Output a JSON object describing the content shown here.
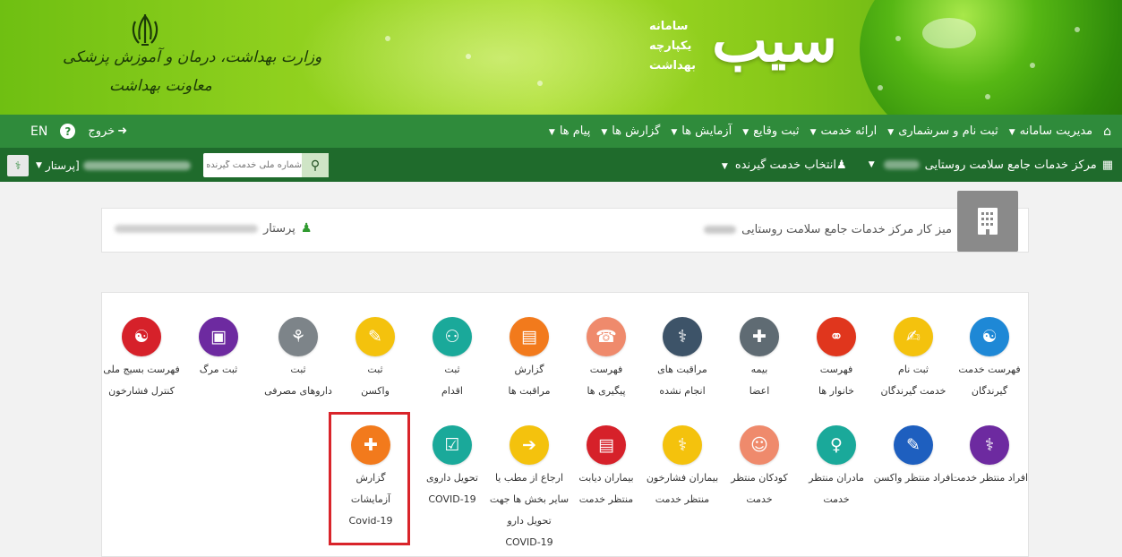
{
  "banner": {
    "ministry_line1": "وزارت بهداشت، درمان و آموزش پزشکی",
    "ministry_line2": "معاونت بهداشت",
    "logo_word": "سیب",
    "logo_line1": "سامانه",
    "logo_line2": "یکپارچه",
    "logo_line3": "بهداشت"
  },
  "mainnav": {
    "items": [
      "مدیریت سامانه",
      "ثبت نام و سرشماری",
      "ارائه خدمت",
      "ثبت وقایع",
      "آزمایش ها",
      "گزارش ها",
      "پیام ها"
    ],
    "home_icon": "home-icon",
    "exit_label": "خروج",
    "help_label": "?",
    "lang_label": "EN"
  },
  "subbar": {
    "center_label": "مرکز خدمات جامع سلامت روستایی",
    "select_client_label": "انتخاب خدمت گیرنده",
    "search_placeholder": "شماره ملی خدمت گیرنده",
    "role_label": "پرستار]"
  },
  "desk": {
    "title": "میز کار مرکز خدمات جامع سلامت روستایی",
    "user_role": "پرستار"
  },
  "tiles_row1": [
    {
      "l1": "فهرست خدمت",
      "l2": "گیرندگان",
      "color": "#1e88d6",
      "glyph": "👥"
    },
    {
      "l1": "ثبت نام",
      "l2": "خدمت گیرندگان",
      "color": "#f4c20d",
      "glyph": "✍"
    },
    {
      "l1": "فهرست",
      "l2": "خانوار ها",
      "color": "#e0361d",
      "glyph": "⚭"
    },
    {
      "l1": "بیمه",
      "l2": "اعضا",
      "color": "#5f6b73",
      "glyph": "✚"
    },
    {
      "l1": "مراقبت های",
      "l2": "انجام نشده",
      "color": "#3d5368",
      "glyph": "⚕"
    },
    {
      "l1": "فهرست",
      "l2": "پیگیری ها",
      "color": "#ef8a6c",
      "glyph": "☎"
    },
    {
      "l1": "گزارش",
      "l2": "مراقبت ها",
      "color": "#f27a1c",
      "glyph": "▤"
    },
    {
      "l1": "ثبت",
      "l2": "اقدام",
      "color": "#1aa99a",
      "glyph": "⚇"
    },
    {
      "l1": "ثبت",
      "l2": "واکسن",
      "color": "#f4c20d",
      "glyph": "💉"
    },
    {
      "l1": "ثبت",
      "l2": "داروهای مصرفی",
      "color": "#7d8489",
      "glyph": "⚘"
    },
    {
      "l1": "ثبت مرگ",
      "l2": "",
      "color": "#6d2aa0",
      "glyph": "🚑"
    },
    {
      "l1": "فهرست بسیج ملی",
      "l2": "کنترل فشارخون",
      "color": "#d6212a",
      "glyph": "👥"
    }
  ],
  "tiles_row2": [
    {
      "l1": "افراد منتظر خدمت",
      "l2": "",
      "l3": "",
      "l4": "",
      "color": "#6d2aa0",
      "glyph": "⚕"
    },
    {
      "l1": "افراد منتظر واکسن",
      "l2": "",
      "l3": "",
      "l4": "",
      "color": "#1e5fbf",
      "glyph": "💉"
    },
    {
      "l1": "مادران منتظر",
      "l2": "خدمت",
      "l3": "",
      "l4": "",
      "color": "#1aa99a",
      "glyph": "♀"
    },
    {
      "l1": "کودکان منتظر",
      "l2": "خدمت",
      "l3": "",
      "l4": "",
      "color": "#ef8a6c",
      "glyph": "☺"
    },
    {
      "l1": "بیماران فشارخون",
      "l2": "منتظر خدمت",
      "l3": "",
      "l4": "",
      "color": "#f4c20d",
      "glyph": "⚕"
    },
    {
      "l1": "بیماران دیابت",
      "l2": "منتظر خدمت",
      "l3": "",
      "l4": "",
      "color": "#d6212a",
      "glyph": "▤"
    },
    {
      "l1": "ارجاع از مطب یا",
      "l2": "سایر بخش ها جهت",
      "l3": "تحویل دارو",
      "l4": "COVID-19",
      "color": "#f4c20d",
      "glyph": "➔"
    },
    {
      "l1": "تحویل داروی",
      "l2": "COVID-19",
      "l3": "",
      "l4": "",
      "color": "#1aa99a",
      "glyph": "☑"
    },
    {
      "l1": "گزارش",
      "l2": "آزمایشات",
      "l3": "Covid-19",
      "l4": "",
      "color": "#f27a1c",
      "glyph": "✚"
    }
  ]
}
